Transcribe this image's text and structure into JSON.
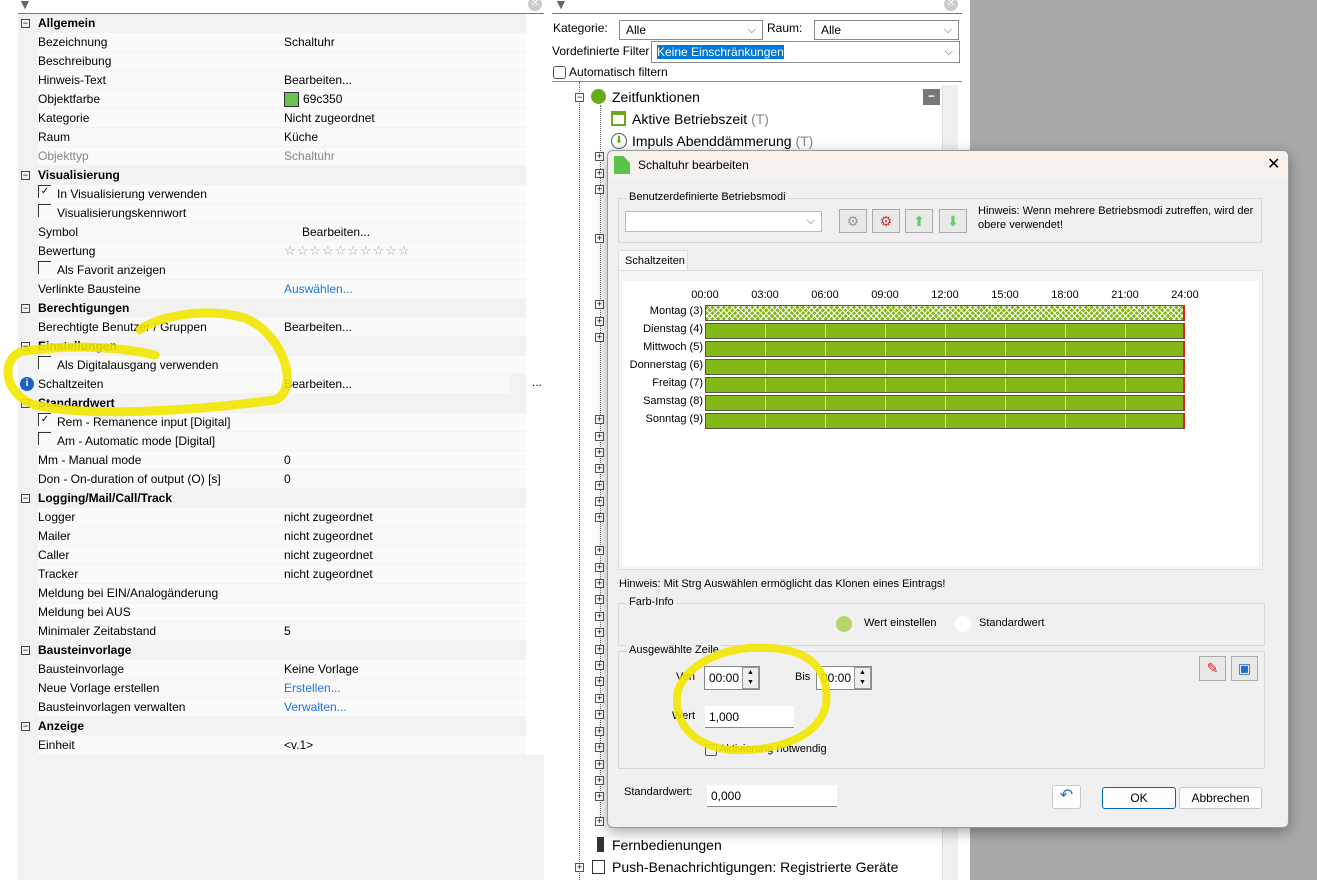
{
  "left_panel": {
    "sections": [
      {
        "title": "Allgemein",
        "rows": [
          {
            "label": "Bezeichnung",
            "value": "Schaltuhr"
          },
          {
            "label": "Beschreibung",
            "value": ""
          },
          {
            "label": "Hinweis-Text",
            "value": "Bearbeiten..."
          },
          {
            "label": "Objektfarbe",
            "value": "69c350",
            "swatch": "#69c350"
          },
          {
            "label": "Kategorie",
            "value": "Nicht zugeordnet"
          },
          {
            "label": "Raum",
            "value": "Küche"
          },
          {
            "label": "Objekttyp",
            "value": "Schaltuhr",
            "disabled": true
          }
        ]
      },
      {
        "title": "Visualisierung",
        "rows": [
          {
            "label": "In Visualisierung verwenden",
            "checkbox": true,
            "checked": true
          },
          {
            "label": "Visualisierungskennwort",
            "checkbox": true,
            "checked": false
          },
          {
            "label": "Symbol",
            "value": "Bearbeiten..."
          },
          {
            "label": "Bewertung",
            "value": "",
            "stars": 10,
            "rating": 0
          },
          {
            "label": "Als Favorit anzeigen",
            "checkbox": true,
            "checked": false
          },
          {
            "label": "Verlinkte Bausteine",
            "value": "Auswählen...",
            "link": true
          }
        ]
      },
      {
        "title": "Berechtigungen",
        "rows": [
          {
            "label": "Berechtigte Benutzer / Gruppen",
            "value": "Bearbeiten..."
          }
        ]
      },
      {
        "title": "Einstellungen",
        "rows": [
          {
            "label": "Als Digitalausgang verwenden",
            "checkbox": true,
            "checked": false
          },
          {
            "label": "Schaltzeiten",
            "value": "Bearbeiten...",
            "info": true,
            "ellipsis": "..."
          }
        ]
      },
      {
        "title": "Standardwert",
        "rows": [
          {
            "label": "Rem - Remanence input [Digital]",
            "checkbox": true,
            "checked": true
          },
          {
            "label": "Am - Automatic mode [Digital]",
            "checkbox": true,
            "checked": false
          },
          {
            "label": "Mm - Manual mode",
            "value": "0"
          },
          {
            "label": "Don - On-duration of output (O) [s]",
            "value": "0"
          }
        ]
      },
      {
        "title": "Logging/Mail/Call/Track",
        "rows": [
          {
            "label": "Logger",
            "value": "nicht zugeordnet"
          },
          {
            "label": "Mailer",
            "value": "nicht zugeordnet"
          },
          {
            "label": "Caller",
            "value": "nicht zugeordnet"
          },
          {
            "label": "Tracker",
            "value": "nicht zugeordnet"
          },
          {
            "label": "Meldung bei EIN/Analogänderung",
            "value": ""
          },
          {
            "label": "Meldung bei AUS",
            "value": ""
          },
          {
            "label": "Minimaler Zeitabstand",
            "value": "5"
          }
        ]
      },
      {
        "title": "Bausteinvorlage",
        "rows": [
          {
            "label": "Bausteinvorlage",
            "value": "Keine Vorlage"
          },
          {
            "label": "Neue Vorlage erstellen",
            "value": "Erstellen...",
            "link": true
          },
          {
            "label": "Bausteinvorlagen verwalten",
            "value": "Verwalten...",
            "link": true
          }
        ]
      },
      {
        "title": "Anzeige",
        "rows": [
          {
            "label": "Einheit",
            "value": "<v.1>"
          }
        ]
      }
    ]
  },
  "filter": {
    "kategorie_label": "Kategorie:",
    "kategorie_value": "Alle",
    "raum_label": "Raum:",
    "raum_value": "Alle",
    "predef_label": "Vordefinierte Filter",
    "predef_value": "Keine Einschränkungen",
    "auto_label": "Automatisch filtern"
  },
  "tree": {
    "zeitfunktionen": "Zeitfunktionen",
    "aktive": "Aktive Betriebszeit",
    "aktive_tag": "(T)",
    "impuls": "Impuls Abenddämmerung",
    "impuls_tag": "(T)",
    "fernbedienungen": "Fernbedienungen",
    "push": "Push-Benachrichtigungen: Registrierte Geräte"
  },
  "dialog": {
    "title": "Schaltuhr bearbeiten",
    "modes_group": "Benutzerdefinierte Betriebsmodi",
    "modes_value": "",
    "modes_hint": "Hinweis: Wenn mehrere Betriebsmodi zutreffen, wird der obere verwendet!",
    "tab": "Schaltzeiten",
    "chart_data": {
      "type": "timeline",
      "hours": [
        "00:00",
        "03:00",
        "06:00",
        "09:00",
        "12:00",
        "15:00",
        "18:00",
        "21:00",
        "24:00"
      ],
      "days": [
        {
          "label": "Montag (3)",
          "start": "00:00",
          "end": "24:00",
          "selected": true
        },
        {
          "label": "Dienstag (4)",
          "start": "00:00",
          "end": "24:00"
        },
        {
          "label": "Mittwoch (5)",
          "start": "00:00",
          "end": "24:00"
        },
        {
          "label": "Donnerstag (6)",
          "start": "00:00",
          "end": "24:00"
        },
        {
          "label": "Freitag (7)",
          "start": "00:00",
          "end": "24:00"
        },
        {
          "label": "Samstag (8)",
          "start": "00:00",
          "end": "24:00"
        },
        {
          "label": "Sonntag (9)",
          "start": "00:00",
          "end": "24:00"
        }
      ],
      "bar_color": "#84b818"
    },
    "clone_hint": "Hinweis: Mit Strg Auswählen ermöglicht das Klonen eines Eintrags!",
    "farb_group": "Farb-Info",
    "legend_set": "Wert einstellen",
    "legend_set_color": "#b5d56a",
    "legend_default": "Standardwert",
    "legend_default_color": "#ffffff",
    "sel_group": "Ausgewählte Zeile",
    "von_label": "Von",
    "von_value": "00:00",
    "bis_label": "Bis",
    "bis_value": "00:00",
    "wert_label": "Wert",
    "wert_value": "1,000",
    "aktivierung_label": "Aktivierung notwendig",
    "standard_label": "Standardwert:",
    "standard_value": "0,000",
    "ok": "OK",
    "cancel": "Abbrechen"
  }
}
